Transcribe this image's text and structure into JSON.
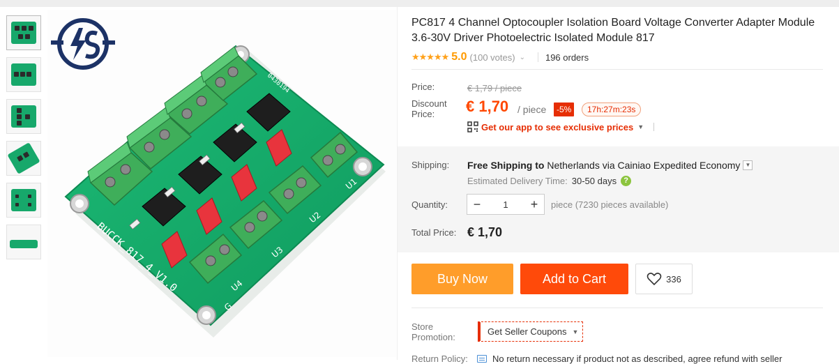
{
  "product": {
    "title": "PC817 4 Channel Optocoupler Isolation Board Voltage Converter Adapter Module 3.6-30V Driver Photoelectric Isolated Module 817",
    "rating": "5.0",
    "stars": "★★★★★",
    "votes": "(100 votes)",
    "orders": "196 orders"
  },
  "gallery": {
    "thumbnail_count": 6,
    "board_labels": {
      "model": "BUCCK_817_4_V1.0",
      "code": "0438194",
      "channels": [
        "U1",
        "U2",
        "U3",
        "U4"
      ],
      "ground": "G"
    }
  },
  "price": {
    "price_label": "Price:",
    "old_price": "€ 1,79 / piece",
    "discount_label_1": "Discount",
    "discount_label_2": "Price:",
    "current": "€ 1,70",
    "unit": "/ piece",
    "discount_badge": "-5%",
    "countdown": "17h:27m:23s",
    "app_promo": "Get our app to see exclusive prices"
  },
  "shipping": {
    "label": "Shipping:",
    "free_shipping": "Free Shipping to",
    "country": "Netherlands",
    "via": "via",
    "carrier": "Cainiao Expedited Economy",
    "est_label": "Estimated Delivery Time:",
    "est_days": "30-50 days"
  },
  "quantity": {
    "label": "Quantity:",
    "value": "1",
    "availability": "piece (7230 pieces available)"
  },
  "total": {
    "label": "Total Price:",
    "value": "€ 1,70"
  },
  "actions": {
    "buy_now": "Buy Now",
    "add_to_cart": "Add to Cart",
    "wishlist_count": "336"
  },
  "store": {
    "label_1": "Store",
    "label_2": "Promotion:",
    "coupons": "Get Seller Coupons"
  },
  "return_policy": {
    "label": "Return Policy:",
    "text": "No return necessary if product not as described, agree refund with seller"
  },
  "colors": {
    "accent": "#ff4700",
    "buy_now": "#ff9d2a",
    "add_to_cart": "#ff4a0a",
    "pcb_green": "#17a86b",
    "terminal_green": "#3fae5a"
  }
}
